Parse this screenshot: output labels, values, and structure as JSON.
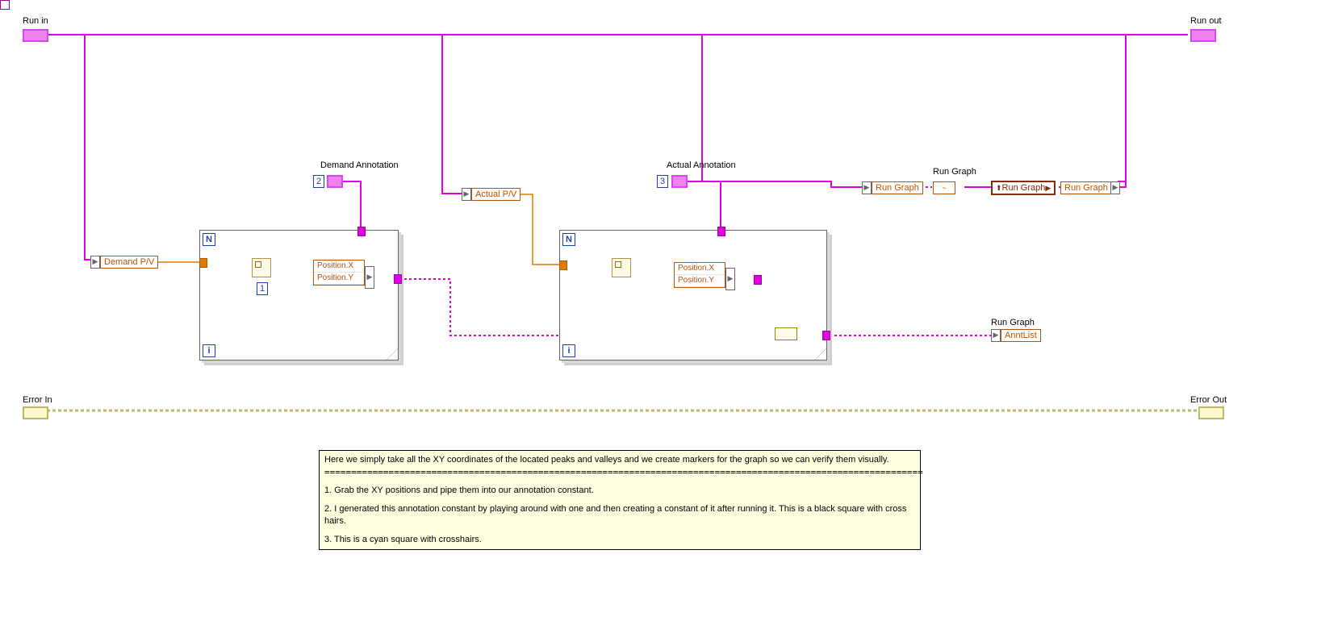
{
  "labels": {
    "runIn": "Run in",
    "runOut": "Run out",
    "errorIn": "Error In",
    "errorOut": "Error Out",
    "demandAnn": "Demand Annotation",
    "actualAnn": "Actual Annotation",
    "runGraphTop": "Run Graph",
    "runGraphMid": "Run Graph",
    "runGraphMid2": "Run Graph",
    "runGraphBottom": "Run Graph",
    "demandPV": "Demand P/V",
    "actualPV": "Actual P/V",
    "posX": "Position.X",
    "posY": "Position.Y",
    "anntList": "AnntList",
    "N": "N",
    "i": "i",
    "num1": "1",
    "num2": "2",
    "num3": "3",
    "wave": "~"
  },
  "comment": {
    "line1": "Here we simply take all the XY coordinates of the located peaks and valleys and we create markers for the graph so we can verify them visually.",
    "div": "================================================================================================================",
    "item1": "1. Grab the XY positions and pipe them into our annotation constant.",
    "item2": "2. I generated this annotation constant by playing around with one and then creating a constant of it after running it. This is a black square with cross hairs.",
    "item3": "3. This is a cyan square with crosshairs."
  }
}
